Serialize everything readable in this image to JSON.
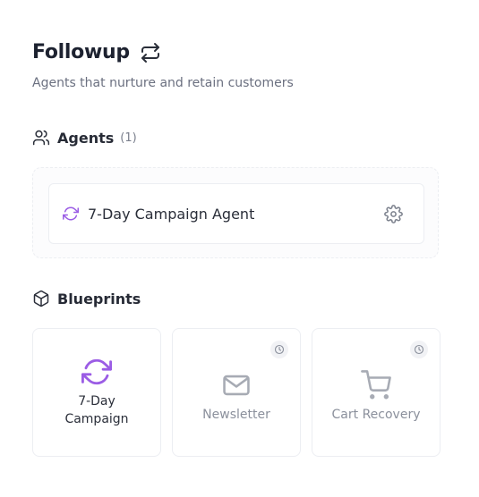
{
  "header": {
    "title": "Followup",
    "title_icon": "repeat-icon",
    "subtitle": "Agents that nurture and retain customers"
  },
  "agents_section": {
    "label": "Agents",
    "count": "(1)",
    "icon": "users-icon",
    "items": [
      {
        "name": "7-Day Campaign Agent",
        "icon": "refresh-icon",
        "action_icon": "gear-icon"
      }
    ]
  },
  "blueprints_section": {
    "label": "Blueprints",
    "icon": "box-icon",
    "items": [
      {
        "label": "7-Day Campaign",
        "icon": "refresh-icon",
        "status": "available"
      },
      {
        "label": "Newsletter",
        "icon": "mail-icon",
        "status": "coming-soon"
      },
      {
        "label": "Cart Recovery",
        "icon": "cart-icon",
        "status": "coming-soon"
      }
    ]
  },
  "colors": {
    "accent_purple": "#9b5de5",
    "muted_icon": "#a7abb4",
    "text_primary": "#1d2230",
    "text_muted": "#6b7080"
  }
}
